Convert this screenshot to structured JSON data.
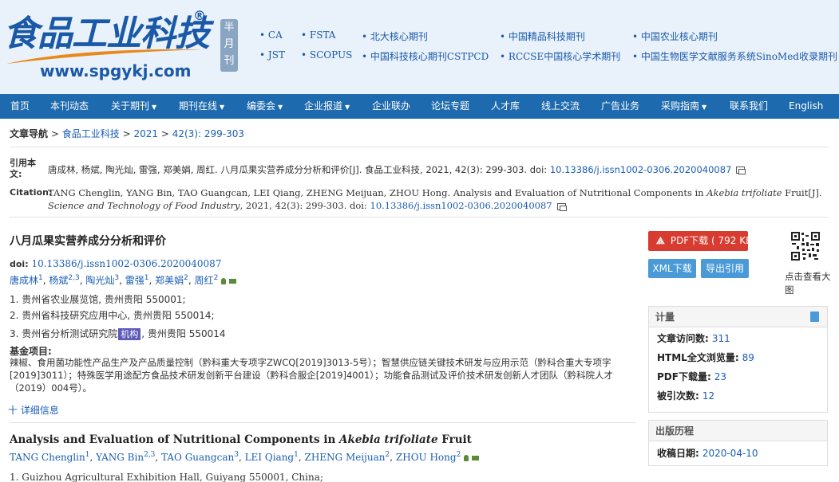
{
  "header": {
    "logo_text": "食品工业科技",
    "logo_reg": "®",
    "url": "www.spgykj.com",
    "badge": [
      "半",
      "月",
      "刊"
    ],
    "indexes": [
      "CA",
      "FSTA",
      "北大核心期刊",
      "中国精品科技期刊",
      "中国农业核心期刊",
      "JST",
      "SCOPUS",
      "中国科技核心期刊CSTPCD",
      "RCCSE中国核心学术期刊",
      "中国生物医学文献服务系统SinoMed收录期刊"
    ]
  },
  "nav": {
    "items": [
      "首页",
      "本刊动态",
      "关于期刊",
      "期刊在线",
      "编委会",
      "企业报道",
      "企业联办",
      "论坛专题",
      "人才库",
      "线上交流",
      "广告业务",
      "采购指南",
      "联系我们",
      "English"
    ],
    "caret": "▼"
  },
  "breadcrumb": {
    "label": "文章导航",
    "sep": ">",
    "journal": "食品工业科技",
    "year": "2021",
    "issue": "42(3): 299-303"
  },
  "citation": {
    "cn_label": "引用本文:",
    "cn_text": "唐成林, 杨斌, 陶光灿, 雷强, 郑美娟, 周红. 八月瓜果实营养成分分析和评价[J]. 食品工业科技, 2021, 42(3): 299-303. doi:",
    "cn_doi": "10.13386/j.issn1002-0306.2020040087",
    "en_label": "Citation:",
    "en_text_1": "TANG Chenglin, YANG Bin, TAO Guangcan, LEI Qiang, ZHENG Meijuan, ZHOU Hong. Analysis and Evaluation of Nutritional Components in",
    "en_italic": "Akebia trifoliate",
    "en_text_2": "Fruit[J].",
    "en_journal": "Science and Technology of Food Industry",
    "en_text_3": ", 2021, 42(3): 299-303. doi:",
    "en_doi": "10.13386/j.issn1002-0306.2020040087"
  },
  "article": {
    "title_cn": "八月瓜果实营养成分分析和评价",
    "doi_label": "doi:",
    "doi": "10.13386/j.issn1002-0306.2020040087",
    "authors_cn": [
      {
        "name": "唐成林",
        "sup": "1"
      },
      {
        "name": "杨斌",
        "sup": "2,3"
      },
      {
        "name": "陶光灿",
        "sup": "3"
      },
      {
        "name": "雷强",
        "sup": "1"
      },
      {
        "name": "郑美娟",
        "sup": "2"
      },
      {
        "name": "周红",
        "sup": "2"
      }
    ],
    "aff1": "1. 贵州省农业展览馆, 贵州贵阳 550001;",
    "aff2": "2. 贵州省科技研究应用中心, 贵州贵阳 550014;",
    "aff3_pre": "3. 贵州省分析测试研究院",
    "aff3_tag": "机构",
    "aff3_post": ", 贵州贵阳 550014",
    "fund_label": "基金项目:",
    "fund_text": "辣椒、食用菌功能性产品生产及产品质量控制（黔科重大专项字ZWCQ[2019]3013-5号）；智慧供应链关键技术研发与应用示范（黔科合重大专项字[2019]3011）；特殊医学用途配方食品技术研发创新平台建设（黔科合服企[2019]4001）；功能食品测试及评价技术研发创新人才团队（黔科院人才（2019）004号）。",
    "more_info": "十 详细信息",
    "title_en_1": "Analysis and Evaluation of Nutritional Components in",
    "title_en_italic": "Akebia trifoliate",
    "title_en_2": "Fruit",
    "authors_en": [
      {
        "name": "TANG Chenglin",
        "sup": "1"
      },
      {
        "name": "YANG Bin",
        "sup": "2,3"
      },
      {
        "name": "TAO Guangcan",
        "sup": "3"
      },
      {
        "name": "LEI Qiang",
        "sup": "1"
      },
      {
        "name": "ZHENG Meijuan",
        "sup": "2"
      },
      {
        "name": "ZHOU Hong",
        "sup": "2"
      }
    ],
    "aff_en_1": "1. Guizhou Agricultural Exhibition Hall, Guiyang 550001, China;"
  },
  "sidebar": {
    "pdf_label": "PDF下载 ( 792 KB)",
    "xml_label": "XML下载",
    "cite_label": "导出引用",
    "qr_caption": "点击查看大图",
    "stats_title": "计量",
    "stats": [
      {
        "label": "文章访问数:",
        "value": "311"
      },
      {
        "label": "HTML全文浏览量:",
        "value": "89"
      },
      {
        "label": "PDF下载量:",
        "value": "23"
      },
      {
        "label": "被引次数:",
        "value": "12"
      }
    ],
    "history_title": "出版历程",
    "received_label": "收稿日期:",
    "received_value": "2020-04-10"
  },
  "colors": {
    "nav_bg": "#1e6aae",
    "header_bg": "#e9f2fb",
    "pdf_btn": "#d83b2f",
    "action_btn": "#4a9ad8",
    "link": "#1a5db5"
  }
}
